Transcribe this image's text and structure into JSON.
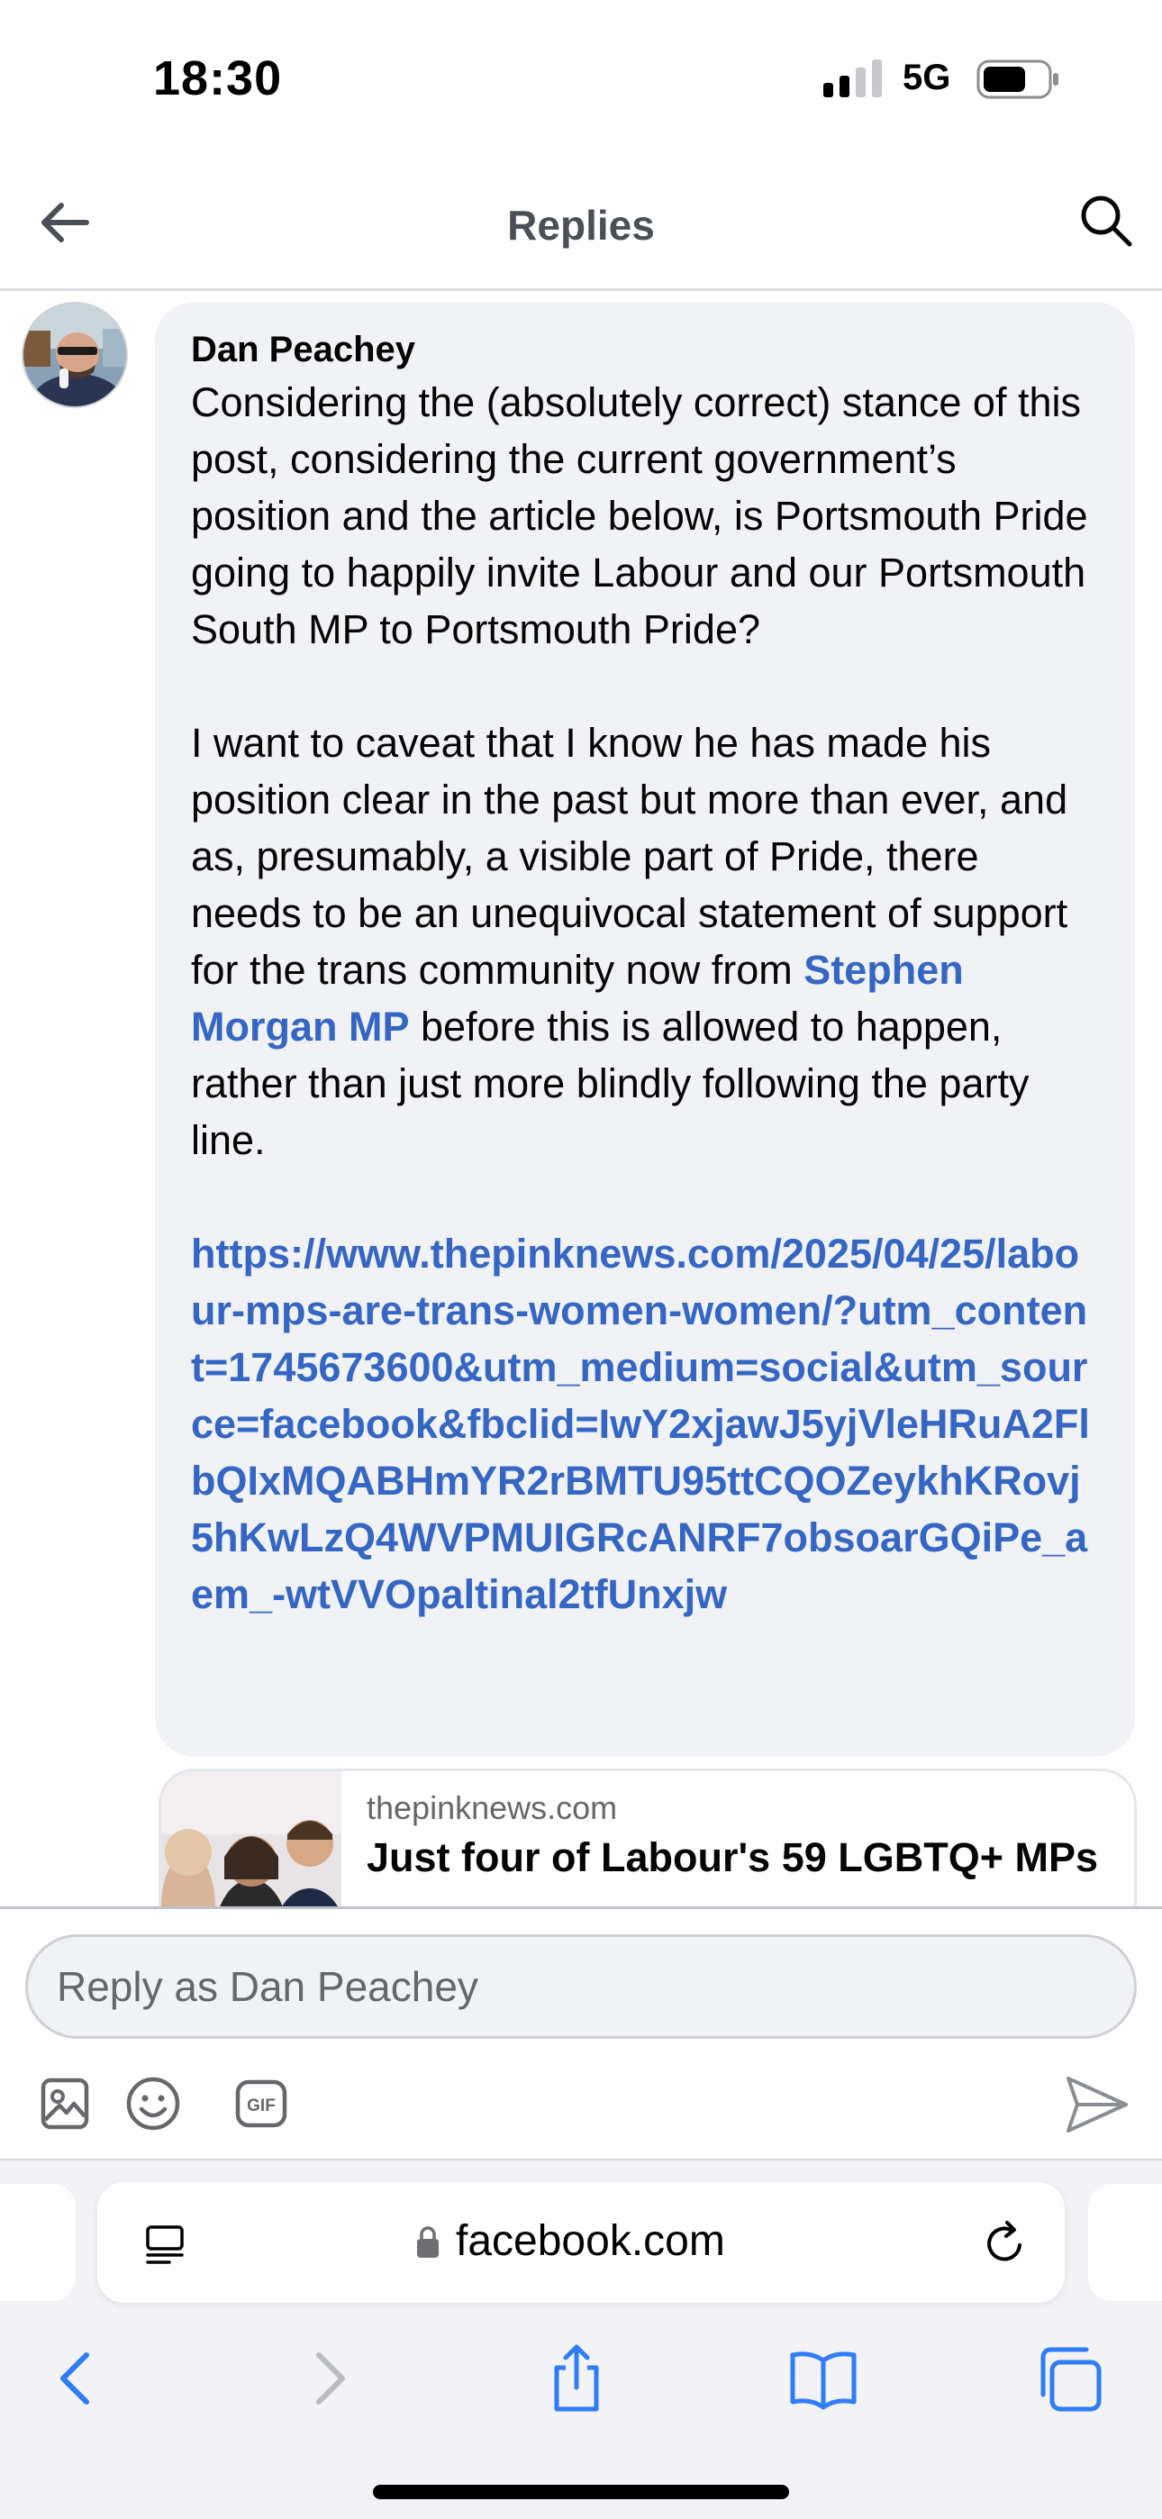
{
  "status_bar": {
    "time": "18:30",
    "network": "5G"
  },
  "header": {
    "title": "Replies"
  },
  "comment": {
    "author": "Dan Peachey",
    "paragraph_1": "Considering the (absolutely correct) stance of this post, considering the current government’s position and the article below, is Portsmouth Pride going to happily invite Labour and our Portsmouth South MP to Portsmouth Pride?",
    "paragraph_2_before": "I want to caveat that I know he has made his position clear in the past but more than ever, and as, presumably, a visible part of Pride, there needs to be an unequivocal statement of support for the trans community now from ",
    "mention": "Stephen Morgan MP",
    "paragraph_2_after": " before this is allowed to happen, rather than just more blindly following the party line.",
    "link": "https://www.thepinknews.com/2025/04/25/labour-mps-are-trans-women-women/?utm_content=1745673600&utm_medium=social&utm_source=facebook&fbclid=IwY2xjawJ5yjVleHRuA2FlbQIxMQABHmYR2rBMTU95ttCQOZeykhKRovj5hKwLzQ4WVPMUIGRcANRF7obsoarGQiPe_aem_-wtVVOpaltinal2tfUnxjw"
  },
  "link_preview": {
    "domain": "thepinknews.com",
    "title": "Just four of Labour's 59 LGBTQ+ MPs"
  },
  "composer": {
    "placeholder": "Reply as Dan Peachey"
  },
  "browser": {
    "url": "facebook.com"
  },
  "colors": {
    "link_blue": "#3566c4",
    "ios_blue": "#2f7cf6",
    "bubble_gray": "#f0f2f5"
  }
}
